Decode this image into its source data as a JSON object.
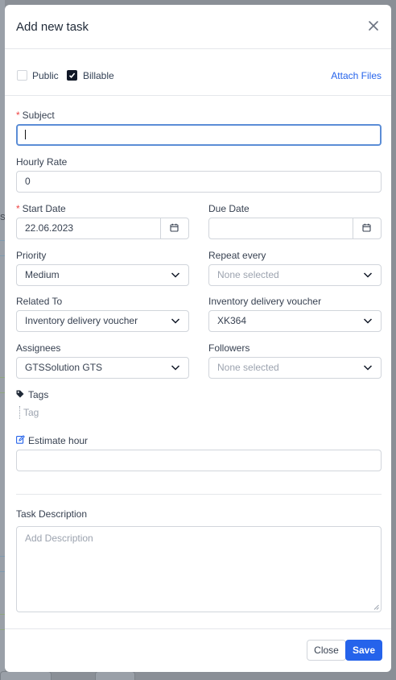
{
  "dialog": {
    "title": "Add new task"
  },
  "options": {
    "public": {
      "label": "Public",
      "checked": false
    },
    "billable": {
      "label": "Billable",
      "checked": true
    },
    "attach_files": "Attach Files"
  },
  "subject": {
    "label": "Subject",
    "value": ""
  },
  "hourly_rate": {
    "label": "Hourly Rate",
    "value": "0"
  },
  "start_date": {
    "label": "Start Date",
    "value": "22.06.2023"
  },
  "due_date": {
    "label": "Due Date",
    "value": ""
  },
  "priority": {
    "label": "Priority",
    "value": "Medium"
  },
  "repeat_every": {
    "label": "Repeat every",
    "placeholder": "None selected"
  },
  "related_to": {
    "label": "Related To",
    "value": "Inventory delivery voucher"
  },
  "inventory_voucher": {
    "label": "Inventory delivery voucher",
    "value": "XK364"
  },
  "assignees": {
    "label": "Assignees",
    "value": "GTSSolution GTS"
  },
  "followers": {
    "label": "Followers",
    "placeholder": "None selected"
  },
  "tags": {
    "label": "Tags",
    "placeholder": "Tag"
  },
  "estimate_hour": {
    "label": "Estimate hour",
    "value": ""
  },
  "description": {
    "label": "Task Description",
    "placeholder": "Add Description"
  },
  "footer": {
    "close_label": "Close",
    "save_label": "Save"
  },
  "colors": {
    "accent": "#2563eb",
    "required": "#ef4444",
    "focus_border": "#5b8dd6"
  },
  "background": {
    "visible_letter": "S"
  }
}
